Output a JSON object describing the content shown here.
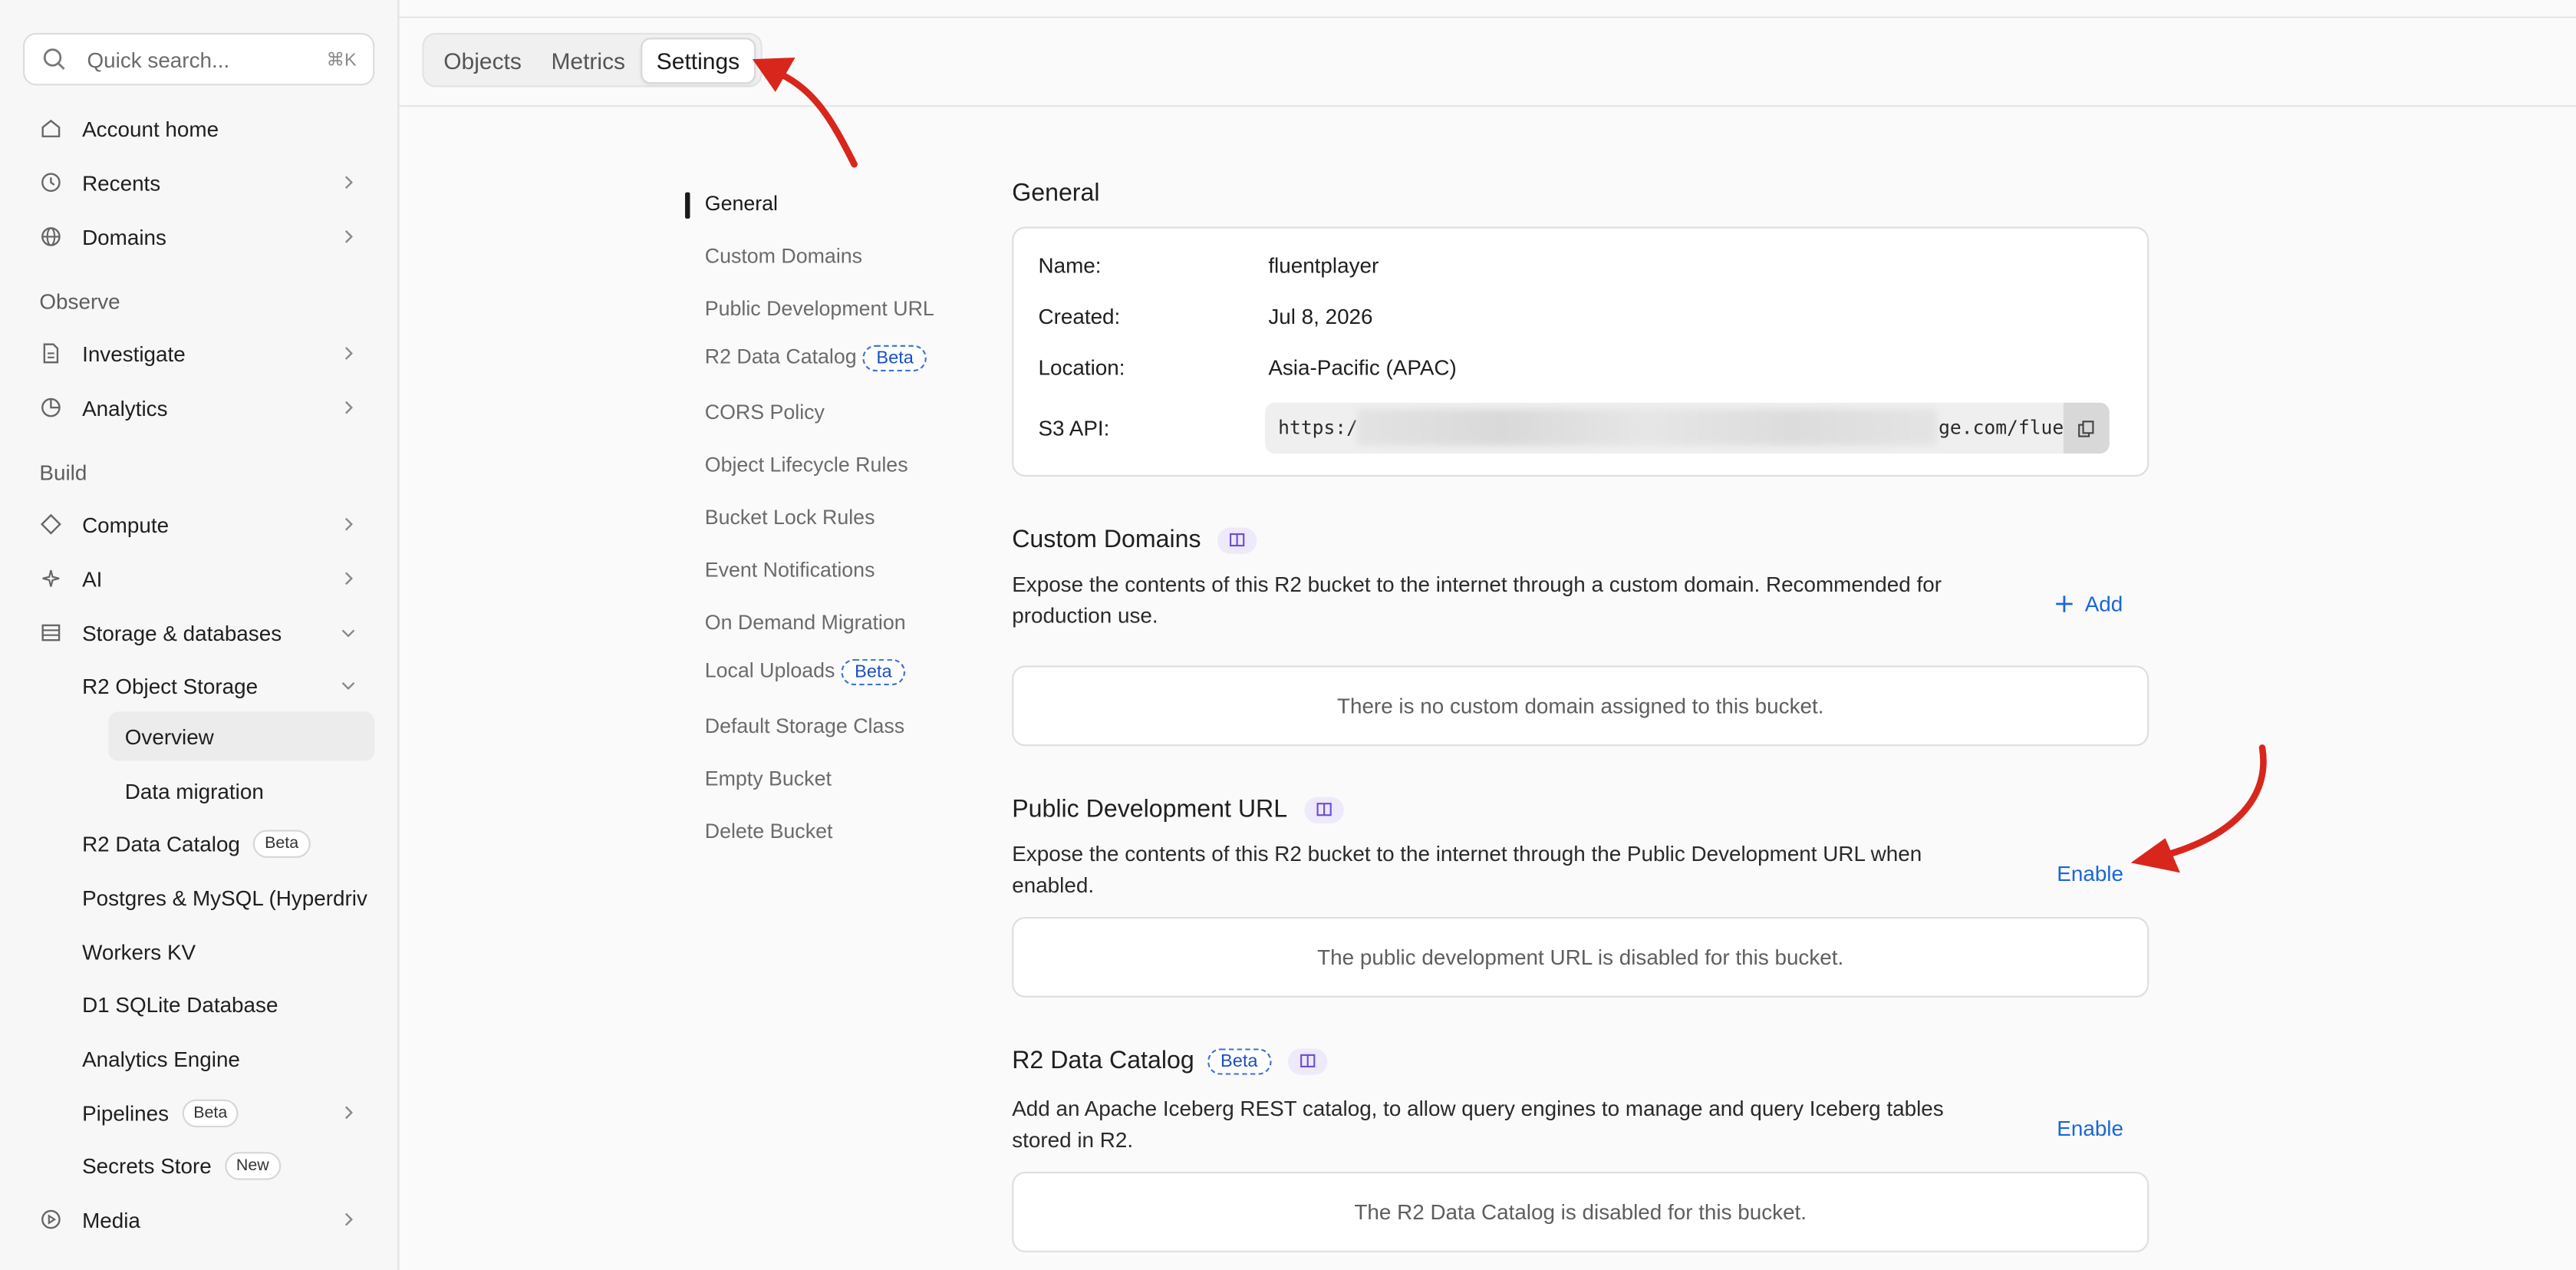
{
  "sidebar": {
    "search": {
      "placeholder": "Quick search...",
      "shortcut": "⌘K"
    },
    "top_items": [
      {
        "label": "Account home"
      },
      {
        "label": "Recents"
      },
      {
        "label": "Domains"
      }
    ],
    "observe_label": "Observe",
    "observe_items": [
      {
        "label": "Investigate"
      },
      {
        "label": "Analytics"
      }
    ],
    "build_label": "Build",
    "build_items": [
      {
        "label": "Compute"
      },
      {
        "label": "AI"
      },
      {
        "label": "Storage & databases"
      }
    ],
    "storage_sub": {
      "r2": "R2 Object Storage",
      "overview": "Overview",
      "data_migration": "Data migration",
      "r2_catalog": "R2 Data Catalog",
      "r2_catalog_badge": "Beta",
      "postgres": "Postgres & MySQL (Hyperdriv",
      "workers_kv": "Workers KV",
      "d1": "D1 SQLite Database",
      "analytics_engine": "Analytics Engine",
      "pipelines": "Pipelines",
      "pipelines_badge": "Beta",
      "secrets": "Secrets Store",
      "secrets_badge": "New"
    },
    "media": "Media"
  },
  "tabs": [
    {
      "label": "Objects"
    },
    {
      "label": "Metrics"
    },
    {
      "label": "Settings"
    }
  ],
  "subnav": [
    {
      "label": "General"
    },
    {
      "label": "Custom Domains"
    },
    {
      "label": "Public Development URL"
    },
    {
      "label": "R2 Data Catalog",
      "badge": "Beta"
    },
    {
      "label": "CORS Policy"
    },
    {
      "label": "Object Lifecycle Rules"
    },
    {
      "label": "Bucket Lock Rules"
    },
    {
      "label": "Event Notifications"
    },
    {
      "label": "On Demand Migration"
    },
    {
      "label": "Local Uploads",
      "badge": "Beta"
    },
    {
      "label": "Default Storage Class"
    },
    {
      "label": "Empty Bucket"
    },
    {
      "label": "Delete Bucket"
    }
  ],
  "general": {
    "title": "General",
    "name_label": "Name:",
    "name_value": "fluentplayer",
    "created_label": "Created:",
    "created_value": "Jul 8, 2026",
    "location_label": "Location:",
    "location_value": "Asia-Pacific (APAC)",
    "s3_label": "S3 API:",
    "s3_prefix": "https:/",
    "s3_suffix": "ge.com/fluen"
  },
  "custom_domains": {
    "title": "Custom Domains",
    "description": "Expose the contents of this R2 bucket to the internet through a custom domain. Recommended for production use.",
    "action": "Add",
    "empty": "There is no custom domain assigned to this bucket."
  },
  "public_dev_url": {
    "title": "Public Development URL",
    "description": "Expose the contents of this R2 bucket to the internet through the Public Development URL when enabled.",
    "action": "Enable",
    "empty": "The public development URL is disabled for this bucket."
  },
  "r2_catalog": {
    "title": "R2 Data Catalog",
    "badge": "Beta",
    "description": "Add an Apache Iceberg REST catalog, to allow query engines to manage and query Iceberg tables stored in R2.",
    "action": "Enable",
    "empty": "The R2 Data Catalog is disabled for this bucket."
  },
  "colors": {
    "accent": "#1a66d9",
    "annotation": "#d9261c",
    "beta": "#1b4fbf"
  }
}
